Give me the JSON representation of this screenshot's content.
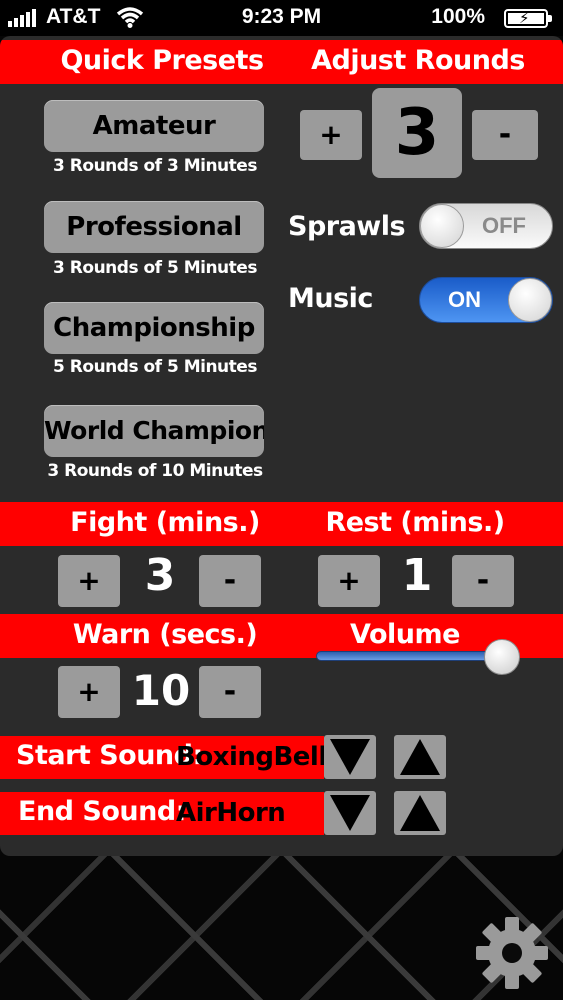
{
  "status_bar": {
    "carrier": "AT&T",
    "time": "9:23 PM",
    "battery": "100%"
  },
  "headers": {
    "quick_presets": "Quick Presets",
    "adjust_rounds": "Adjust Rounds",
    "fight": "Fight (mins.)",
    "rest": "Rest (mins.)",
    "warn": "Warn (secs.)",
    "volume": "Volume"
  },
  "presets": [
    {
      "label": "Amateur",
      "desc": "3 Rounds of 3 Minutes"
    },
    {
      "label": "Professional",
      "desc": "3 Rounds of 5 Minutes"
    },
    {
      "label": "Championship",
      "desc": "5 Rounds of 5 Minutes"
    },
    {
      "label": "World Champion",
      "desc": "3 Rounds of 10 Minutes"
    }
  ],
  "rounds": {
    "plus": "+",
    "value": "3",
    "minus": "-"
  },
  "toggles": {
    "sprawls": {
      "label": "Sprawls",
      "state": "OFF"
    },
    "music": {
      "label": "Music",
      "state": "ON"
    }
  },
  "fight": {
    "plus": "+",
    "value": "3",
    "minus": "-"
  },
  "rest": {
    "plus": "+",
    "value": "1",
    "minus": "-"
  },
  "warn": {
    "plus": "+",
    "value": "10",
    "minus": "-"
  },
  "volume": {
    "level": 0.95
  },
  "sounds": {
    "start": {
      "label": "Start Sound:",
      "value": "BoxingBell"
    },
    "end": {
      "label": "End Sound:",
      "value": "AirHorn"
    }
  },
  "icons": {
    "settings": "gear-icon",
    "down": "triangle-down-icon",
    "up": "triangle-up-icon"
  },
  "colors": {
    "accent_red": "#ff0000",
    "panel": "#2b2b2b",
    "button_gray": "#9b9b9b",
    "toggle_blue": "#2f78e6"
  }
}
